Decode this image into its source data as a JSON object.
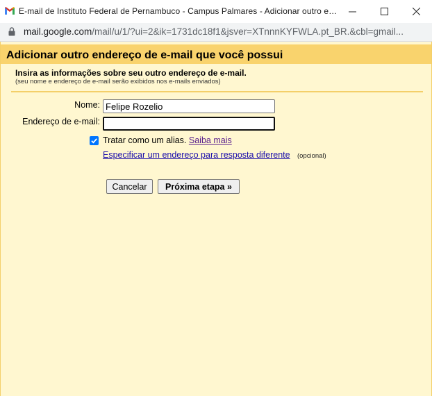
{
  "window": {
    "title": "E-mail de Instituto Federal de Pernambuco - Campus Palmares - Adicionar outro endereço de e-mail que você possui",
    "url_host": "mail.google.com",
    "url_rest": "/mail/u/1/?ui=2&ik=1731dc18f1&jsver=XTnnnKYFWLA.pt_BR.&cbl=gmail..."
  },
  "dialog": {
    "title": "Adicionar outro endereço de e-mail que você possui",
    "intro_title": "Insira as informações sobre seu outro endereço de e-mail.",
    "intro_sub": "(seu nome e endereço de e-mail serão exibidos nos e-mails enviados)"
  },
  "form": {
    "name_label": "Nome:",
    "name_value": "Felipe Rozelio",
    "email_label": "Endereço de e-mail:",
    "email_value": "",
    "alias_checked": true,
    "alias_label": "Tratar como um alias.",
    "learn_more_link": "Saiba mais",
    "reply_to_link": "Especificar um endereço para resposta diferente",
    "optional_note": "(opcional)"
  },
  "buttons": {
    "cancel_label": "Cancelar",
    "next_label": "Próxima etapa »"
  },
  "colors": {
    "dialog_bg": "#fff7d0",
    "header_bg": "#f9d36d",
    "checkbox": "#0075ff"
  }
}
